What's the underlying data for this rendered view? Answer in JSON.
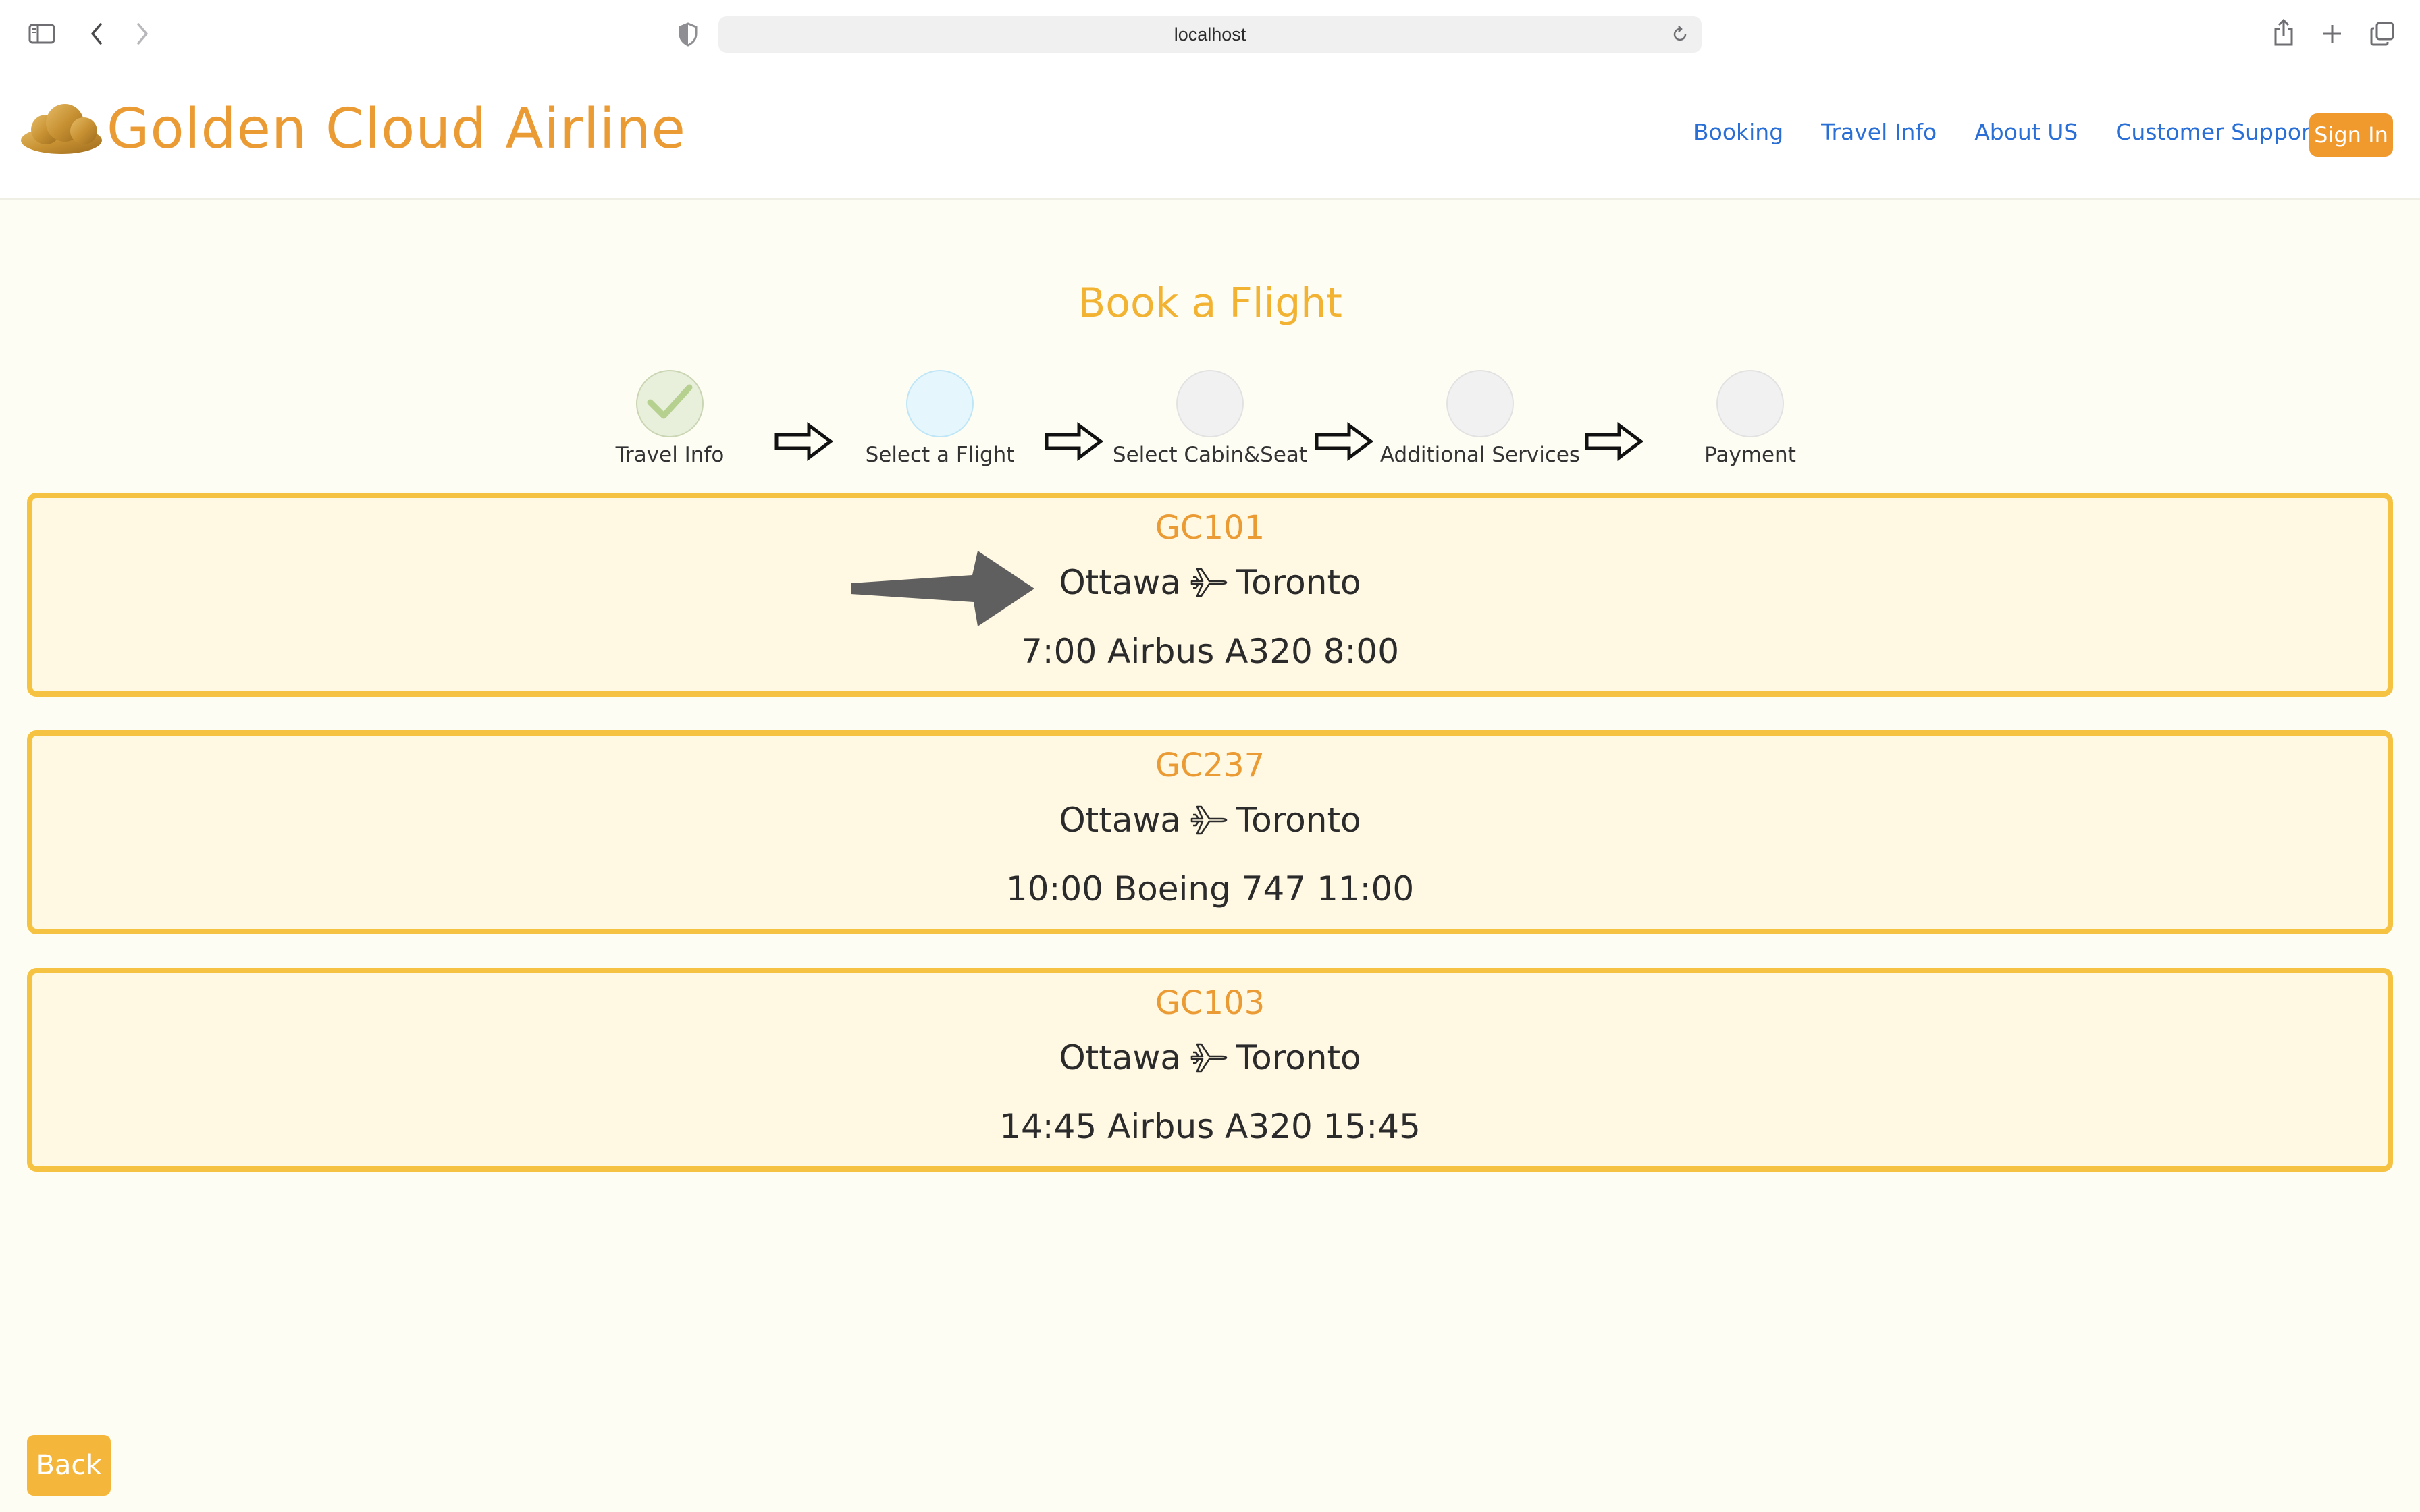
{
  "browser": {
    "url": "localhost"
  },
  "header": {
    "brand": "Golden Cloud Airline",
    "nav": [
      "Booking",
      "Travel Info",
      "About US",
      "Customer Support"
    ],
    "sign_in": "Sign In"
  },
  "main": {
    "title": "Book a Flight",
    "steps": [
      {
        "label": "Travel Info",
        "state": "done"
      },
      {
        "label": "Select a Flight",
        "state": "active"
      },
      {
        "label": "Select Cabin&Seat",
        "state": "pending"
      },
      {
        "label": "Additional Services",
        "state": "pending"
      },
      {
        "label": "Payment",
        "state": "pending"
      }
    ],
    "flights": [
      {
        "number": "GC101",
        "from": "Ottawa",
        "to": "Toronto",
        "departure": "7:00",
        "aircraft": "Airbus A320",
        "arrival": "8:00"
      },
      {
        "number": "GC237",
        "from": "Ottawa",
        "to": "Toronto",
        "departure": "10:00",
        "aircraft": "Boeing 747",
        "arrival": "11:00"
      },
      {
        "number": "GC103",
        "from": "Ottawa",
        "to": "Toronto",
        "departure": "14:45",
        "aircraft": "Airbus A320",
        "arrival": "15:45"
      }
    ],
    "back": "Back"
  },
  "colors": {
    "brand": "#eb9b34",
    "title": "#f2b232",
    "nav_link": "#2a6fd6",
    "card_border": "#f5c242",
    "card_bg": "#fff8e3",
    "page_bg": "#fefdf4"
  },
  "icons": {
    "sidebar": "sidebar-toggle-icon",
    "back": "chevron-left-icon",
    "forward": "chevron-right-icon",
    "shield": "privacy-shield-icon",
    "reload": "reload-icon",
    "share": "share-icon",
    "new_tab": "plus-icon",
    "tabs": "tab-overview-icon",
    "logo": "golden-cloud-icon",
    "step_done": "check-icon",
    "step_arrow": "right-arrow-icon",
    "plane": "airplane-icon",
    "pointer": "pointer-arrow-icon"
  }
}
